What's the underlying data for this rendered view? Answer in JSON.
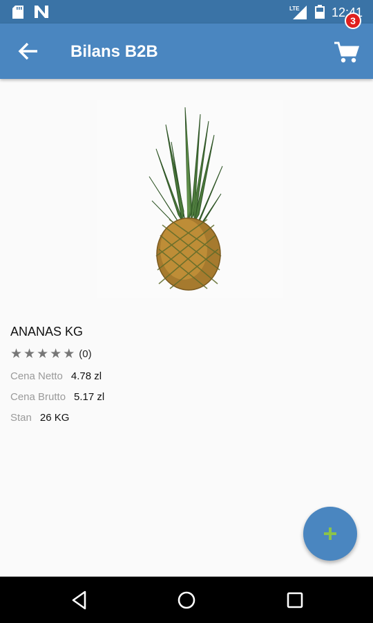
{
  "status_bar": {
    "time": "12:41",
    "network": "LTE"
  },
  "app_bar": {
    "title": "Bilans B2B",
    "cart_count": "3"
  },
  "product": {
    "name": "ANANAS KG",
    "rating_count": "(0)",
    "stars": 0,
    "details": [
      {
        "label": "Cena Netto",
        "value": "4.78 zl"
      },
      {
        "label": "Cena Brutto",
        "value": "5.17 zl"
      },
      {
        "label": "Stan",
        "value": "26 KG"
      }
    ]
  },
  "colors": {
    "status_bar": "#3a73a6",
    "app_bar": "#4a86c0",
    "fab": "#4a86c0",
    "fab_plus": "#8bc34a",
    "badge": "#e0201e"
  },
  "icons": {
    "back": "arrow-left-icon",
    "cart": "shopping-cart-icon",
    "fab": "plus-icon"
  }
}
